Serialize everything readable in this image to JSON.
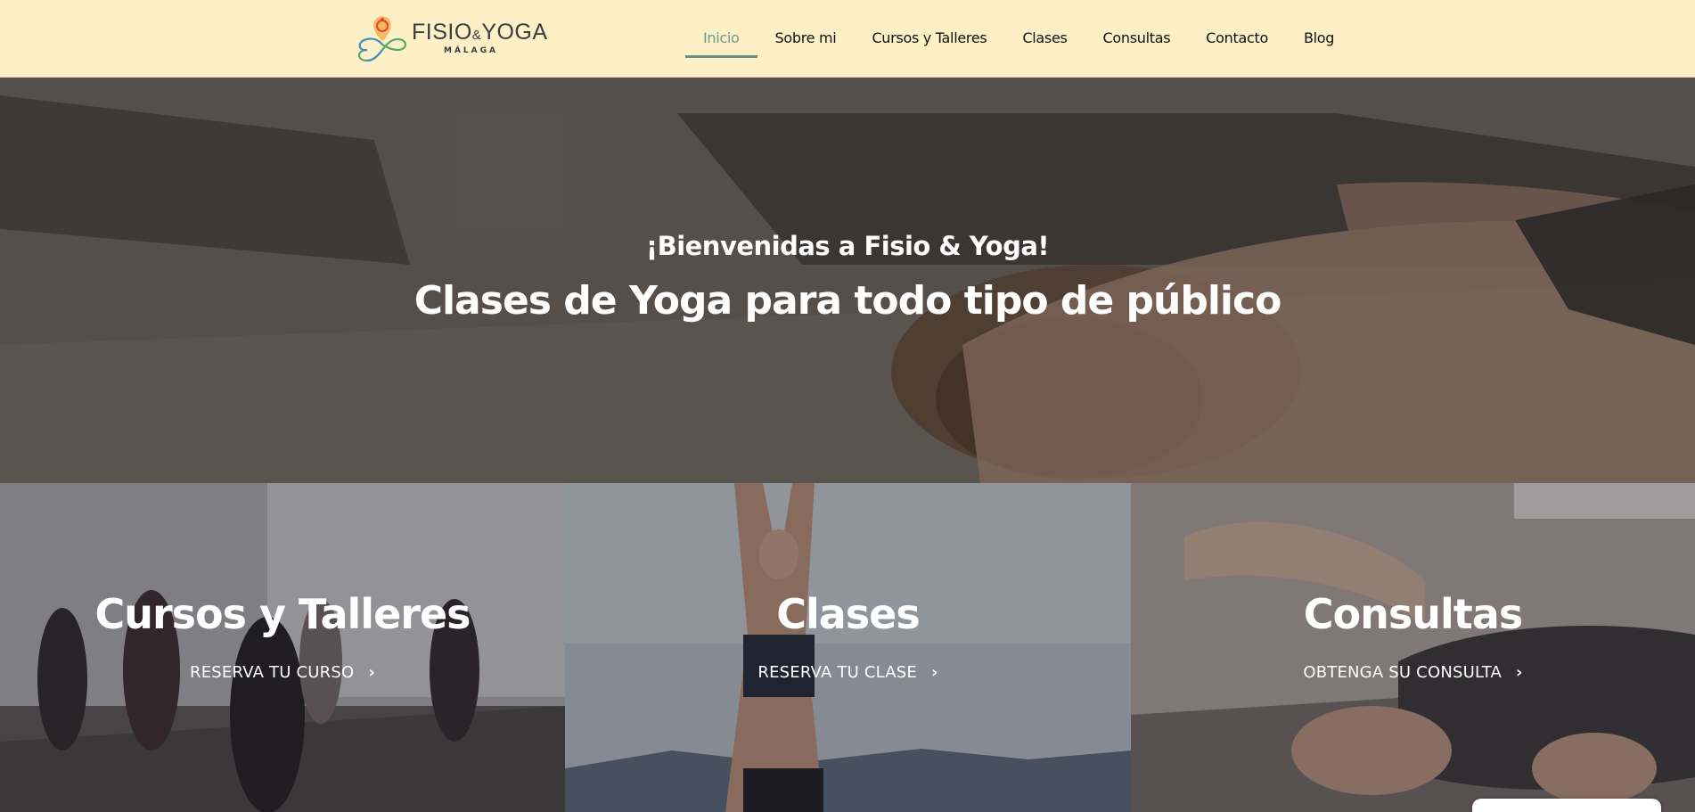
{
  "brand": {
    "name_left": "FISIO",
    "name_amp": "&",
    "name_right": "YOGA",
    "city": "MÁLAGA",
    "colors": {
      "orange": "#f0a13a",
      "red": "#d9463c",
      "green": "#5aa86f",
      "blue": "#3d8fc1"
    }
  },
  "nav": {
    "items": [
      {
        "label": "Inicio",
        "active": true
      },
      {
        "label": "Sobre mi"
      },
      {
        "label": "Cursos y Talleres"
      },
      {
        "label": "Clases"
      },
      {
        "label": "Consultas"
      },
      {
        "label": "Contacto"
      },
      {
        "label": "Blog"
      }
    ],
    "active_color": "#6e9a8f"
  },
  "hero": {
    "subtitle": "¡Bienvenidas a Fisio & Yoga!",
    "title": "Clases de Yoga para todo tipo de público"
  },
  "cards": [
    {
      "title": "Cursos y Talleres",
      "cta": "RESERVA TU CURSO",
      "icon": "chevron-right-icon"
    },
    {
      "title": "Clases",
      "cta": "RESERVA TU CLASE",
      "icon": "chevron-right-icon"
    },
    {
      "title": "Consultas",
      "cta": "OBTENGA SU CONSULTA",
      "icon": "chevron-right-icon"
    }
  ],
  "colors": {
    "header_bg": "#fdefc6",
    "text_dark": "#111111",
    "overlay_text": "#ffffff"
  }
}
